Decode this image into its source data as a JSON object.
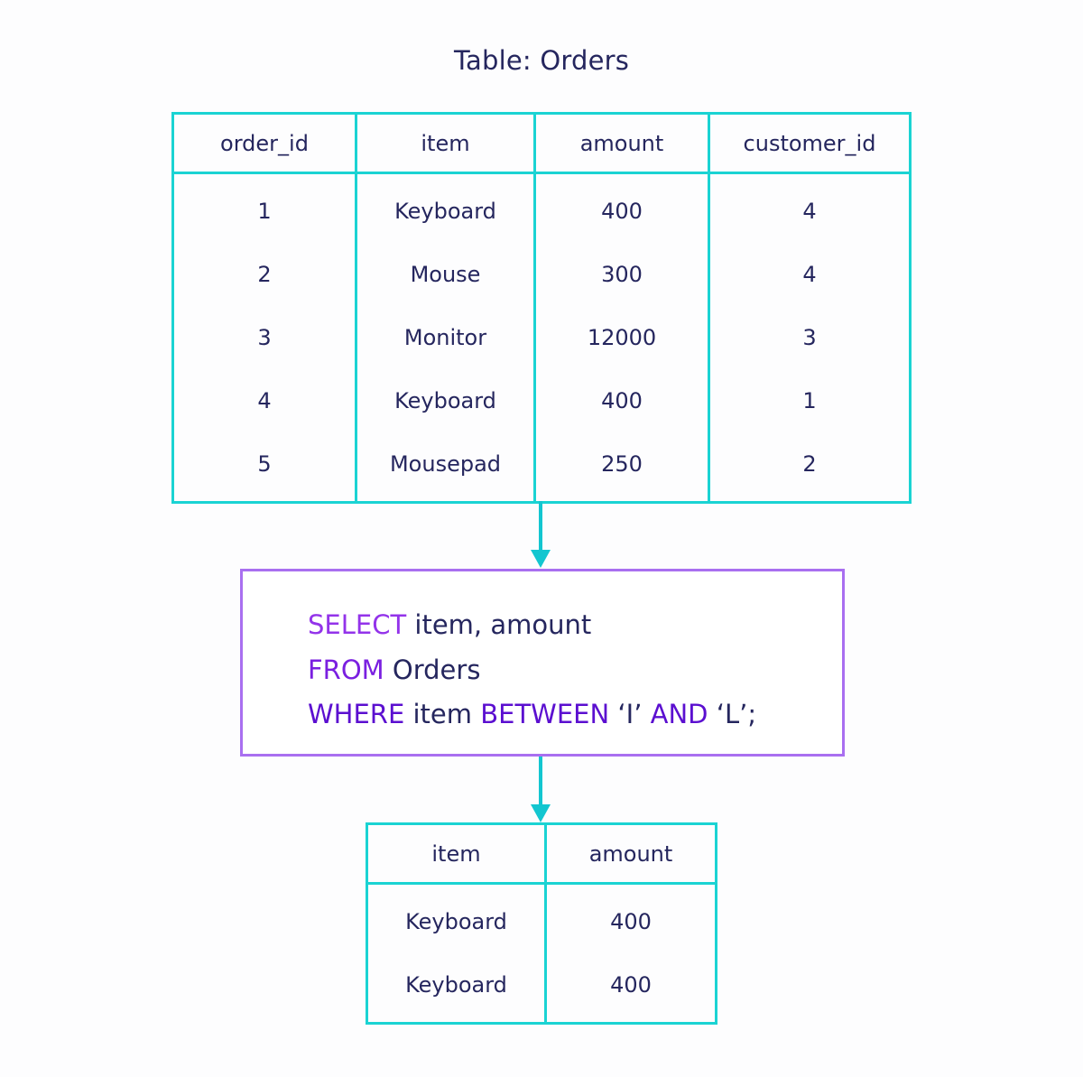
{
  "title": "Table: Orders",
  "orders_table": {
    "columns": [
      "order_id",
      "item",
      "amount",
      "customer_id"
    ],
    "rows": [
      [
        "1",
        "Keyboard",
        "400",
        "4"
      ],
      [
        "2",
        "Mouse",
        "300",
        "4"
      ],
      [
        "3",
        "Monitor",
        "12000",
        "3"
      ],
      [
        "4",
        "Keyboard",
        "400",
        "1"
      ],
      [
        "5",
        "Mousepad",
        "250",
        "2"
      ]
    ]
  },
  "query": {
    "line1": {
      "keyword": "SELECT",
      "rest": " item, amount"
    },
    "line2": {
      "keyword": "FROM",
      "rest": " Orders"
    },
    "line3": {
      "keyword1": "WHERE",
      "text1": " item ",
      "keyword2": "BETWEEN",
      "text2": " ‘I’ ",
      "keyword3": "AND",
      "text3": " ‘L’;"
    }
  },
  "result_table": {
    "columns": [
      "item",
      "amount"
    ],
    "rows": [
      [
        "Keyboard",
        "400"
      ],
      [
        "Keyboard",
        "400"
      ]
    ]
  },
  "colors": {
    "table_border": "#1ad3d3",
    "arrow": "#13c6d0",
    "query_border": "#a96ff0",
    "keyword": "#7a1fe0",
    "text": "#25265e"
  }
}
